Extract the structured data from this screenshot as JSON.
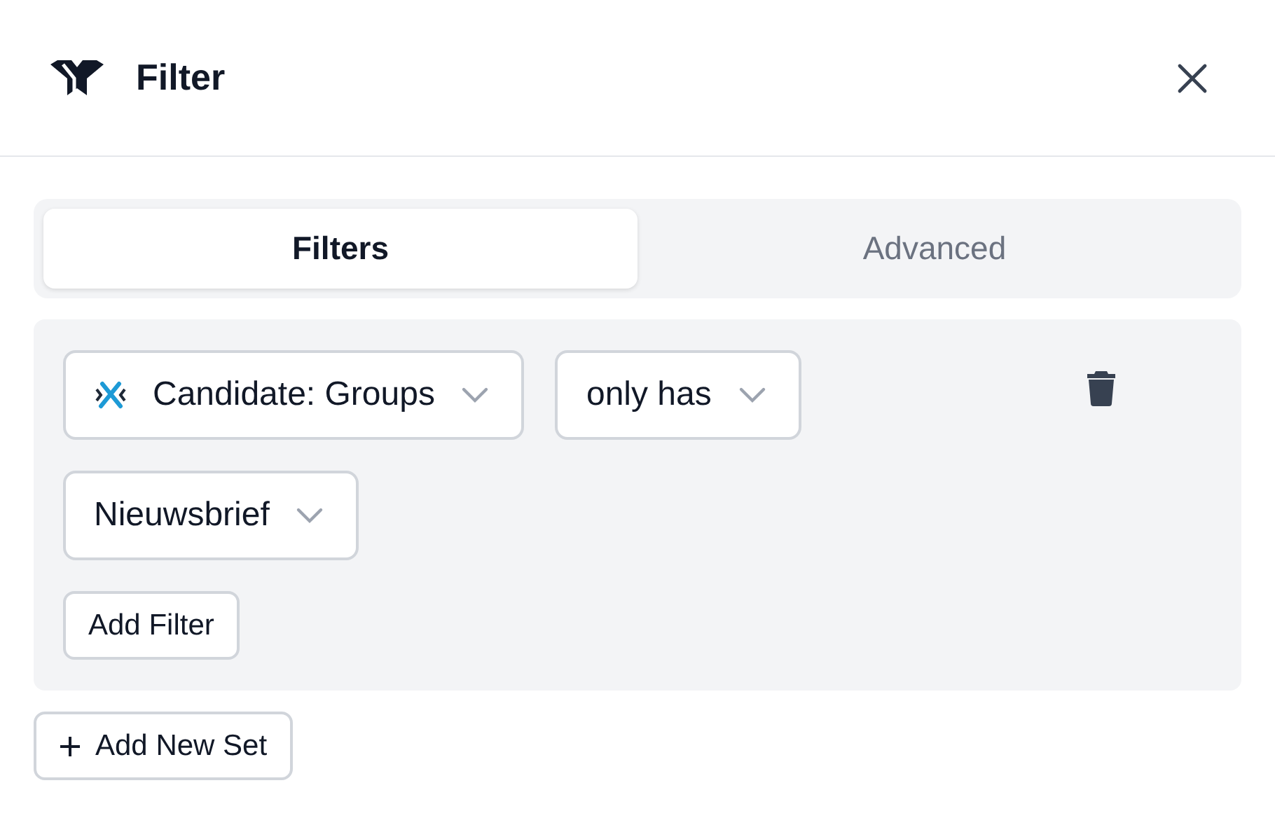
{
  "header": {
    "title": "Filter"
  },
  "tabs": [
    {
      "label": "Filters",
      "selected": true
    },
    {
      "label": "Advanced",
      "selected": false
    }
  ],
  "filter_set": {
    "selects": [
      {
        "kind": "field",
        "value": "Candidate: Groups"
      },
      {
        "kind": "operator",
        "value": "only has"
      },
      {
        "kind": "value",
        "value": "Nieuwsbrief"
      }
    ],
    "add_filter": "Add Filter"
  },
  "add_set": "Add New Set"
}
